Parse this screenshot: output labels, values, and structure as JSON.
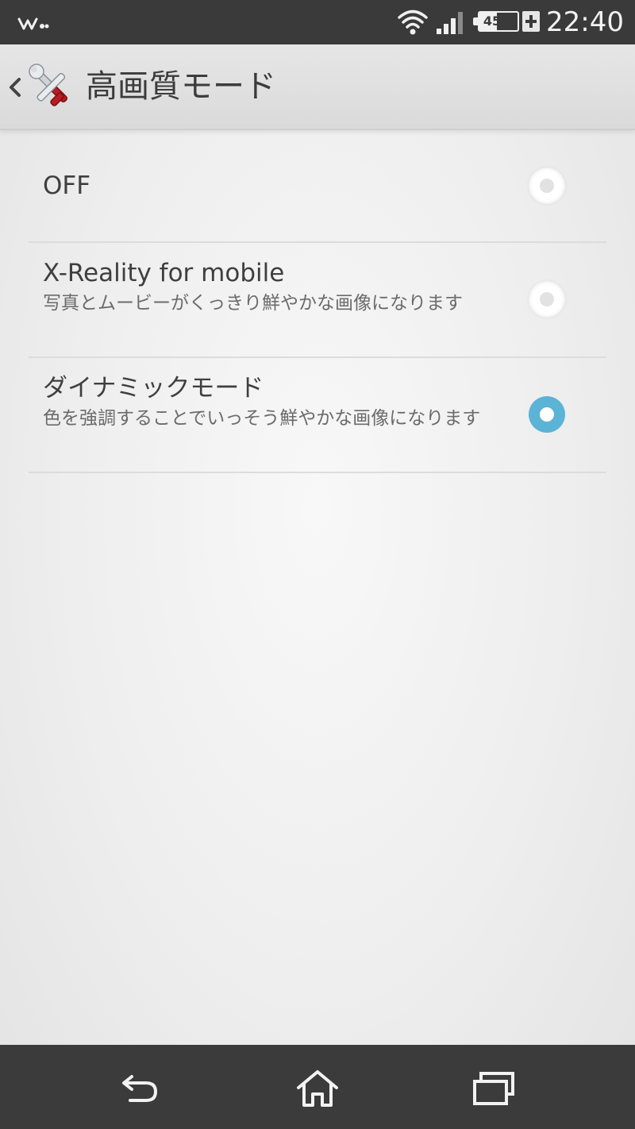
{
  "status_bar": {
    "time": "22:40",
    "battery_percent": "45%",
    "battery_level": 45,
    "icons": [
      "walkman-icon",
      "wifi-icon",
      "signal-icon",
      "battery-icon",
      "charging-icon"
    ]
  },
  "action_bar": {
    "title": "高画質モード",
    "app_icon": "settings-tools-icon"
  },
  "options": [
    {
      "title": "OFF",
      "summary": "",
      "selected": false
    },
    {
      "title": "X-Reality for mobile",
      "summary": "写真とムービーがくっきり鮮やかな画像になります",
      "selected": false
    },
    {
      "title": "ダイナミックモード",
      "summary": "色を強調することでいっそう鮮やかな画像になります",
      "selected": true
    }
  ],
  "nav_bar": {
    "icons": [
      "back-icon",
      "home-icon",
      "recent-apps-icon"
    ]
  },
  "colors": {
    "accent": "#5bb3d6",
    "status_bar_bg": "#3a3a3a",
    "nav_bar_bg": "#3b3b3b"
  }
}
